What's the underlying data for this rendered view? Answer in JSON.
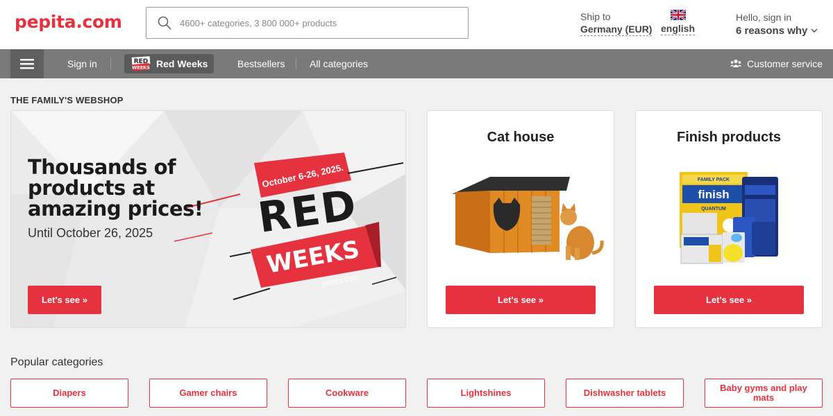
{
  "header": {
    "logo": "pepita.com",
    "search": {
      "placeholder": "4600+ categories, 3 800 000+ products",
      "icon": "search-icon"
    },
    "ship": {
      "label": "Ship to",
      "value": "Germany (EUR)"
    },
    "language": {
      "value": "english",
      "icon": "uk-flag-icon"
    },
    "account": {
      "greeting": "Hello, sign in",
      "value": "6 reasons why"
    }
  },
  "nav": {
    "sign_in": "Sign in",
    "red_weeks": "Red Weeks",
    "red_weeks_badge": [
      "RED",
      "WEEKS"
    ],
    "bestsellers": "Bestsellers",
    "all_categories": "All categories",
    "customer_service": "Customer service"
  },
  "main": {
    "section_title": "THE FAMILY'S WEBSHOP",
    "hero": {
      "headline": "Thousands of products at amazing prices!",
      "subtitle": "Until October 26, 2025",
      "button": "Let's see »",
      "art": {
        "dates": "October 6-26, 2025.",
        "red": "RED",
        "weeks": "WEEKS",
        "site": "pepita.com"
      }
    },
    "cards": [
      {
        "title": "Cat house",
        "button": "Let's see »"
      },
      {
        "title": "Finish products",
        "button": "Let's see »",
        "product_text": [
          "FAMILY PACK",
          "finish",
          "QUANTUM"
        ]
      }
    ]
  },
  "popular": {
    "title": "Popular categories",
    "items": [
      "Diapers",
      "Gamer chairs",
      "Cookware",
      "Lightshines",
      "Dishwasher tablets",
      "Baby gyms and play mats"
    ]
  },
  "colors": {
    "brand_red": "#e5323e",
    "nav_gray": "#7a7a7a"
  }
}
